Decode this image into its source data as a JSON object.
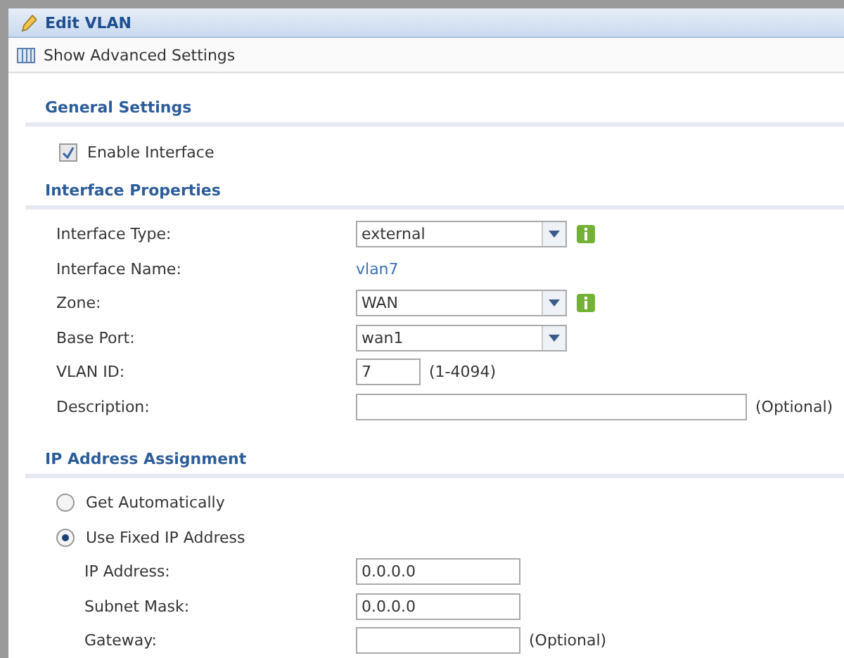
{
  "window": {
    "title": "Edit VLAN"
  },
  "toolbar": {
    "label": "Show Advanced Settings"
  },
  "general": {
    "heading": "General Settings",
    "enable": {
      "label": "Enable Interface",
      "checked": true
    }
  },
  "interface": {
    "heading": "Interface Properties",
    "rows": [
      {
        "kind": "select",
        "label": "Interface Type:",
        "value": "external",
        "info": true
      },
      {
        "kind": "link",
        "label": "Interface Name:",
        "value": "vlan7"
      },
      {
        "kind": "select",
        "label": "Zone:",
        "value": "WAN",
        "info": true
      },
      {
        "kind": "select",
        "label": "Base Port:",
        "value": "wan1",
        "info": false
      },
      {
        "kind": "short",
        "label": "VLAN ID:",
        "value": "7",
        "hint": "(1-4094)"
      },
      {
        "kind": "wide",
        "label": "Description:",
        "hint": "(Optional)"
      }
    ]
  },
  "ip": {
    "heading": "IP Address Assignment",
    "options": [
      {
        "label": "Get Automatically",
        "selected": false
      },
      {
        "label": "Use Fixed IP Address",
        "selected": true
      }
    ],
    "rows": [
      {
        "kind": "medium",
        "label": "IP Address:",
        "value": "0.0.0.0"
      },
      {
        "kind": "medium",
        "label": "Subnet Mask:",
        "value": "0.0.0.0"
      },
      {
        "kind": "medium",
        "label": "Gateway:",
        "hint": "(Optional)"
      }
    ]
  }
}
